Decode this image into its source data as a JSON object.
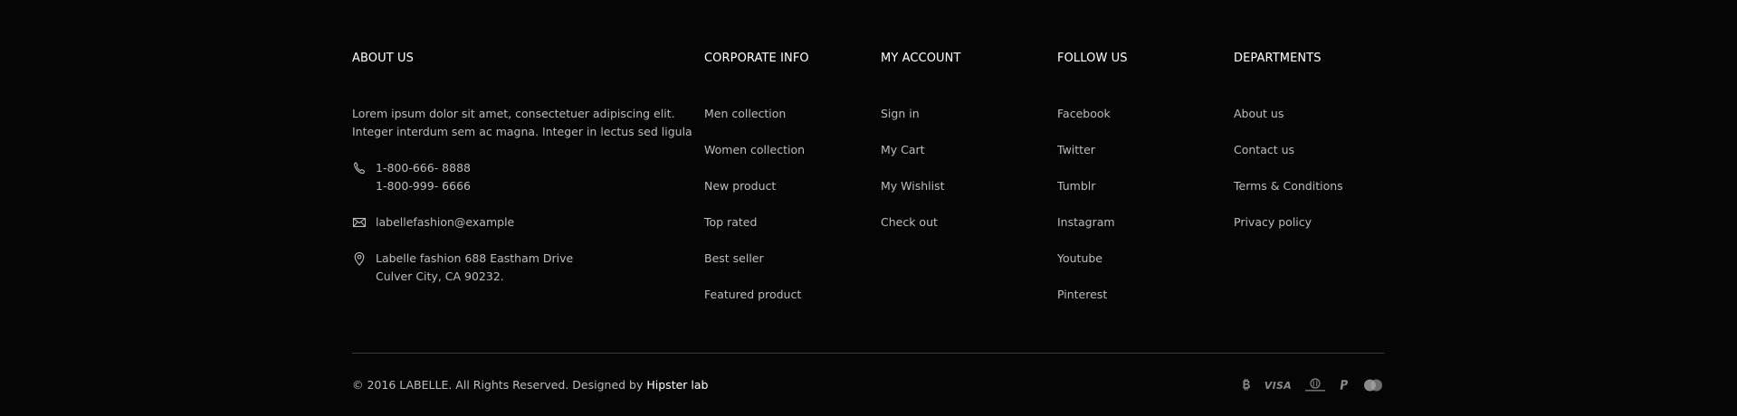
{
  "about": {
    "heading": "ABOUT US",
    "text": "Lorem ipsum dolor sit amet, consectetuer adipiscing elit. Integer interdum sem ac magna. Integer in lectus sed ligula",
    "phone_1": "1-800-666- 8888",
    "phone_2": "1-800-999- 6666",
    "email": "labellefashion@example",
    "address_1": "Labelle fashion 688 Eastham Drive",
    "address_2": "Culver City, CA 90232."
  },
  "corporate": {
    "heading": "CORPORATE INFO",
    "items": [
      "Men collection",
      "Women collection",
      "New product",
      "Top rated",
      "Best seller",
      "Featured product"
    ]
  },
  "account": {
    "heading": "MY ACCOUNT",
    "items": [
      "Sign in",
      "My Cart",
      "My Wishlist",
      "Check out"
    ]
  },
  "follow": {
    "heading": "FOLLOW US",
    "items": [
      "Facebook",
      "Twitter",
      "Tumblr",
      "Instagram",
      "Youtube",
      "Pinterest"
    ]
  },
  "departments": {
    "heading": "DEPARTMENTS",
    "items": [
      "About us",
      "Contact us",
      "Terms & Conditions",
      "Privacy policy"
    ]
  },
  "bottom": {
    "copyright": "© 2016 LABELLE. All Rights Reserved. Designed by ",
    "designer": "Hipster lab",
    "visa_label": "VISA",
    "payment_icons": [
      "bitcoin-icon",
      "visa-icon",
      "diners-club-icon",
      "paypal-icon",
      "mastercard-icon"
    ]
  },
  "colors": {
    "background": "#050505",
    "heading": "#ffffff",
    "text": "#bdbdbd",
    "divider": "#3a3a3a",
    "icon": "#8a8a8a"
  }
}
